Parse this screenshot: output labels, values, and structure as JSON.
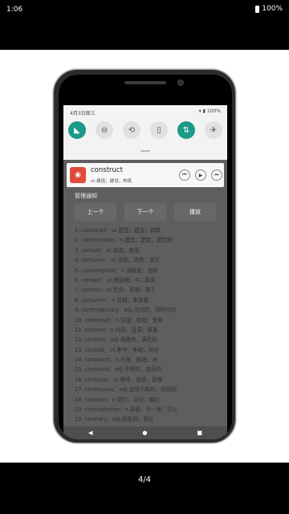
{
  "status_bar": {
    "time": "1:06",
    "battery": "100%"
  },
  "quick_settings": {
    "date": "4月3日周三",
    "tiles": [
      {
        "name": "wifi-off-icon",
        "glyph": "◣",
        "active": true
      },
      {
        "name": "do-not-disturb-icon",
        "glyph": "⊖",
        "active": false
      },
      {
        "name": "auto-rotate-icon",
        "glyph": "⟲",
        "active": false
      },
      {
        "name": "battery-saver-icon",
        "glyph": "▯",
        "active": false
      },
      {
        "name": "mobile-data-icon",
        "glyph": "⇅",
        "active": true
      },
      {
        "name": "airplane-mode-icon",
        "glyph": "✈",
        "active": false
      }
    ]
  },
  "notification": {
    "word": "construct",
    "meaning": "vt.建造；建设；构筑",
    "controls": [
      "⏮",
      "▶",
      "⏭"
    ]
  },
  "manager": {
    "title": "管理通知",
    "prev_label": "上一个",
    "next_label": "下一个",
    "play_label": "播放"
  },
  "words": [
    "1.   construct：vt.建造；建设；构筑",
    "2.   construction：n.建造；建筑；建筑物",
    "3.   consult：vt.谘询，查阅",
    "4.   consume：vt.消耗，消费；消灭",
    "5.   consumption：n.消耗量；消耗",
    "6.   contact：vt.使接触；与...联系",
    "7.   contain：vt.包含，容纳；等于",
    "8.   container：n.容器；集装箱",
    "9.   contemporary：adj.当代的，同时代的",
    "10.   contempt：n.轻蔑；歧视；受辱",
    "11.   content：n.内容，目录；容量",
    "12.   content：adj.满意的，满足的",
    "13.   contest：vt.争夺，争取；辩论",
    "14.   continent：n.大陆，陆地；洲",
    "15.   continual：adj.不断的，连续的",
    "16.   continue：vt.继续，延续；延伸",
    "17.   continuous：adj.连续不断的，持续的",
    "18.   contract：n.契约，合同；婚约",
    "19.   contradiction：n.矛盾，不一致；否认",
    "20.   contrary：adj.相反的；相左"
  ],
  "navbar": {
    "back": "◀",
    "home": "●",
    "recents": "■"
  },
  "viewer": {
    "page": "4/4"
  }
}
